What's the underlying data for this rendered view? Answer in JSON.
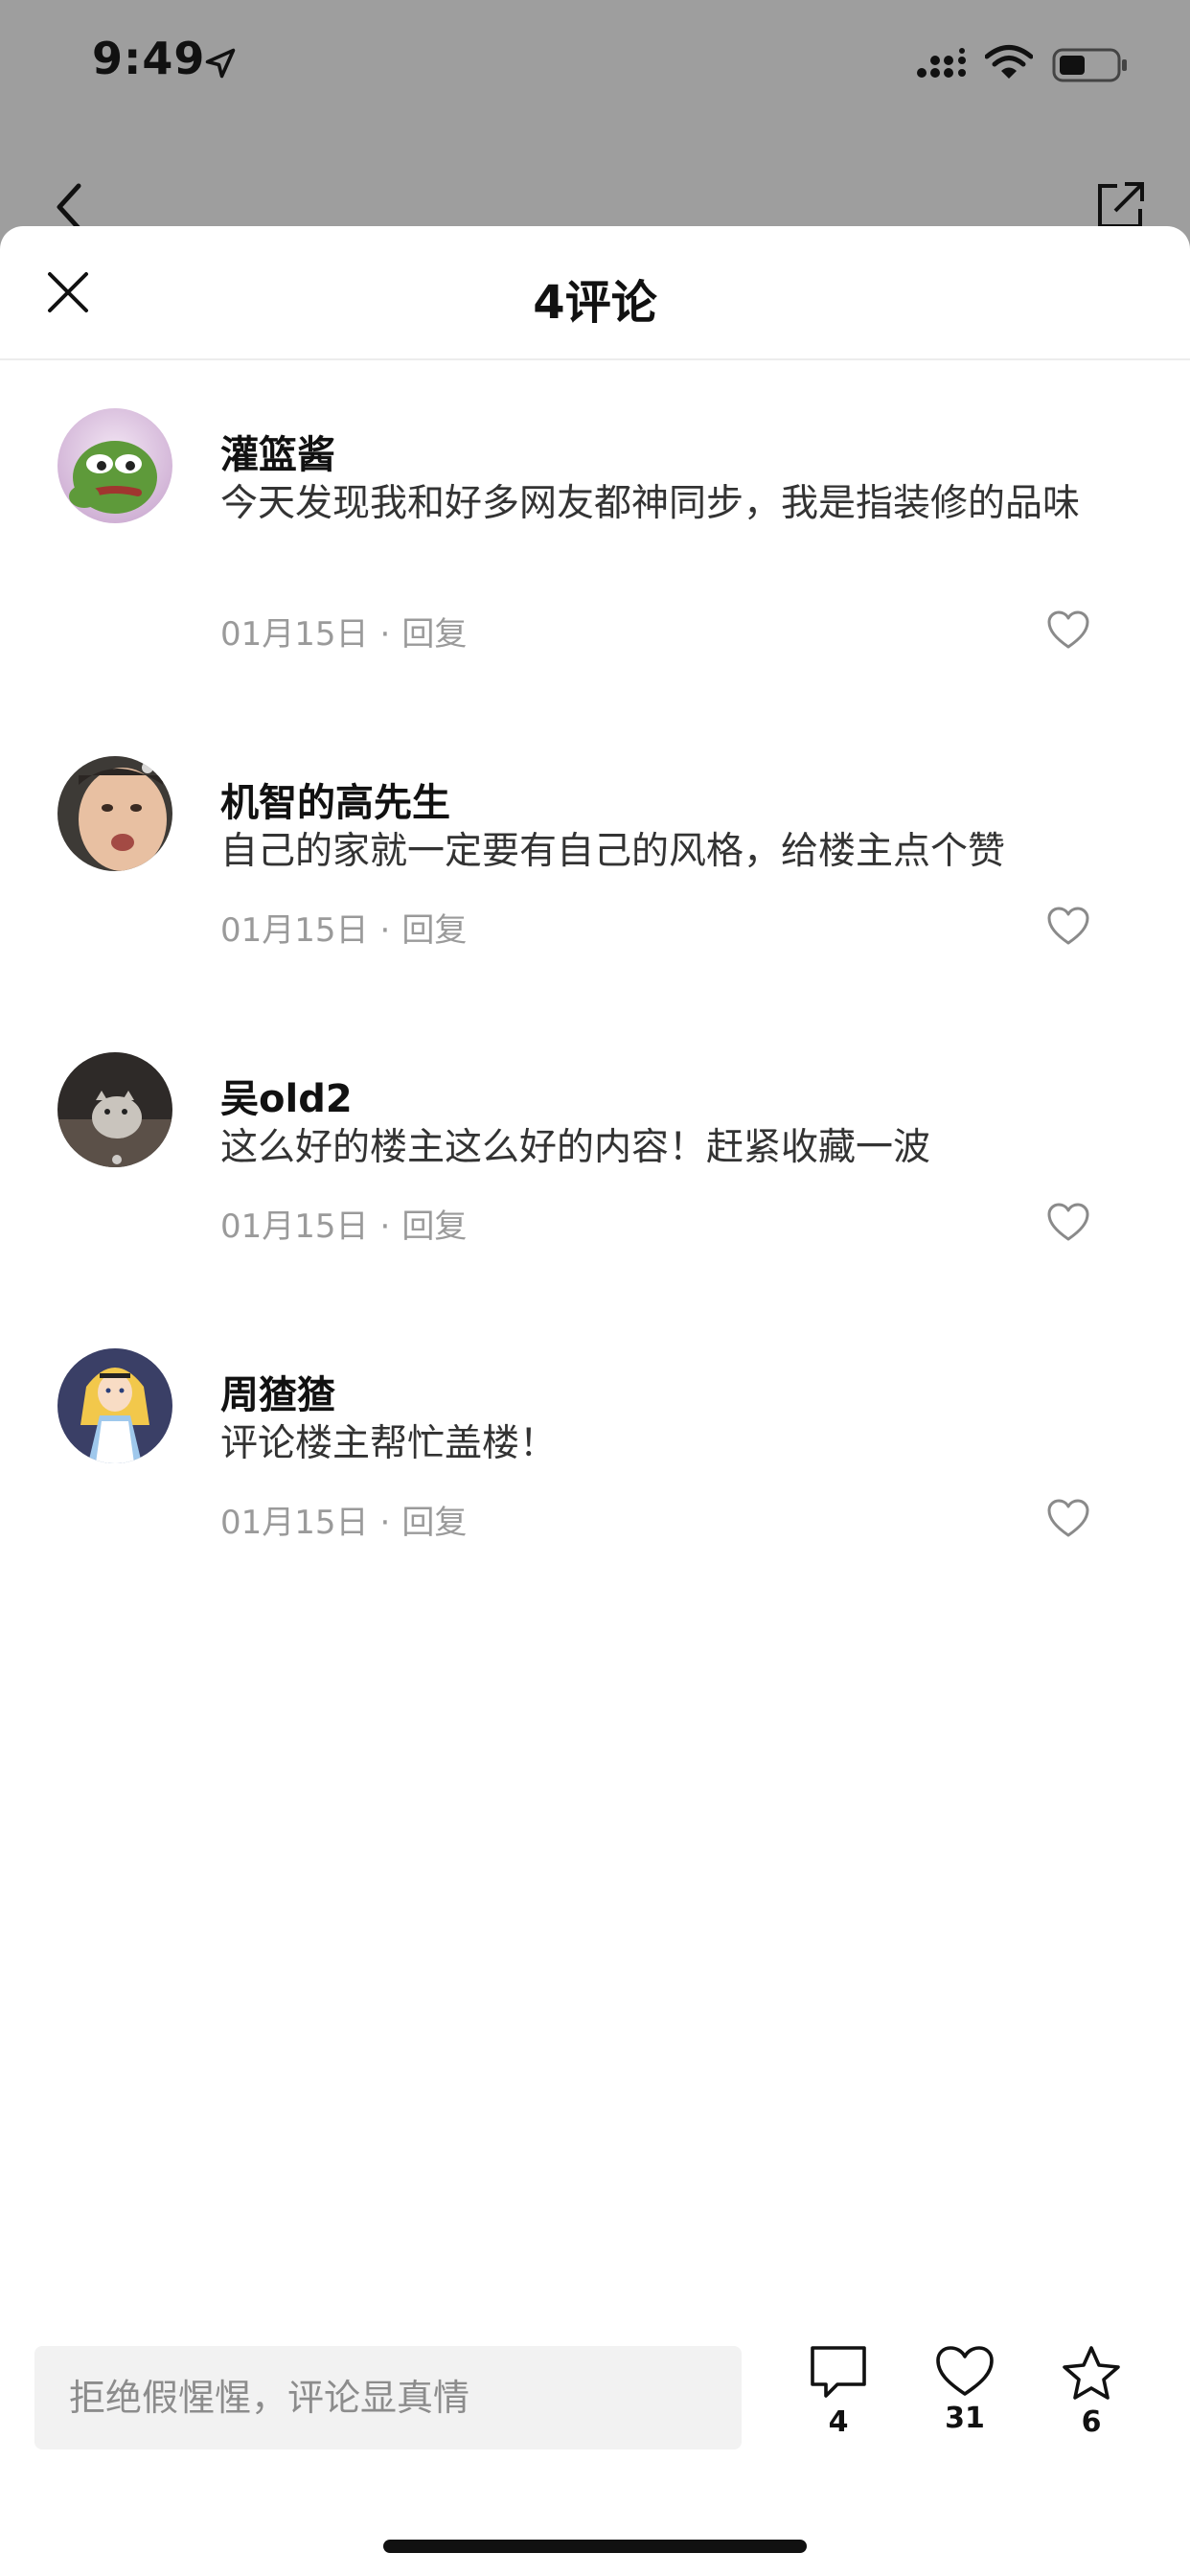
{
  "status_bar": {
    "time": "9:49"
  },
  "sheet": {
    "title": "4评论"
  },
  "comments": [
    {
      "name": "灌篮酱",
      "text": "今天发现我和好多网友都神同步，我是指装修的品味",
      "date": "01月15日",
      "reply_label": "回复",
      "avatar": "pepe-frog"
    },
    {
      "name": "机智的高先生",
      "text": "自己的家就一定要有自己的风格，给楼主点个赞",
      "date": "01月15日",
      "reply_label": "回复",
      "avatar": "crying-child"
    },
    {
      "name": "吴old2",
      "text": "这么好的楼主这么好的内容！赶紧收藏一波",
      "date": "01月15日",
      "reply_label": "回复",
      "avatar": "kitten-photo"
    },
    {
      "name": "周猹猹",
      "text": "评论楼主帮忙盖楼！",
      "date": "01月15日",
      "reply_label": "回复",
      "avatar": "alice-cartoon"
    }
  ],
  "bottom_bar": {
    "input_placeholder": "拒绝假惺惺，评论显真情",
    "comment_count": "4",
    "like_count": "31",
    "favorite_count": "6"
  },
  "colors": {
    "dim_overlay": "#9e9e9e",
    "sheet_bg": "#ffffff",
    "meta_text": "#9a9a9a",
    "input_bg": "#f2f2f2"
  },
  "icons": [
    "location-icon",
    "signal-icon",
    "wifi-icon",
    "battery-icon",
    "back-icon",
    "share-icon",
    "close-icon",
    "heart-icon",
    "comment-icon",
    "star-icon"
  ]
}
